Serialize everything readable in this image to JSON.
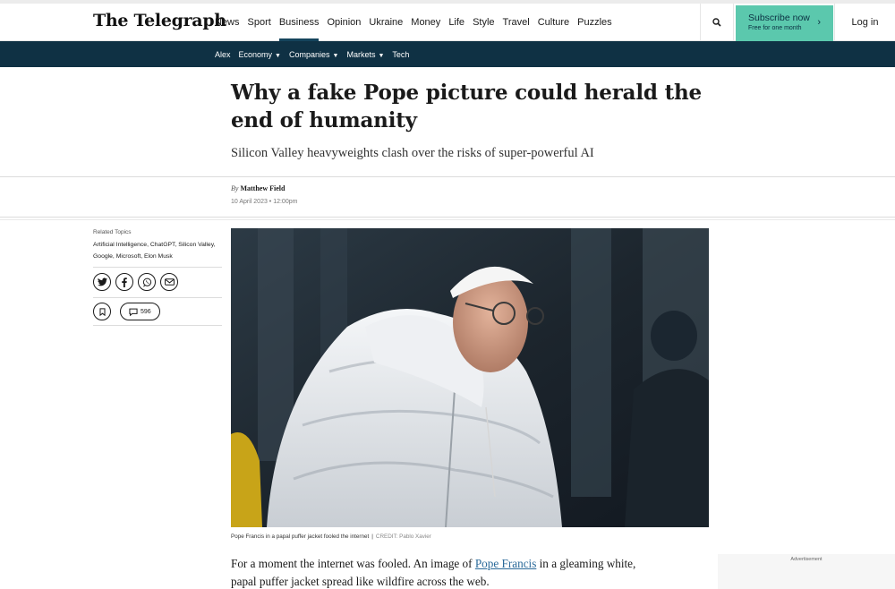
{
  "header": {
    "logo": "The Telegraph",
    "nav": [
      "News",
      "Sport",
      "Business",
      "Opinion",
      "Ukraine",
      "Money",
      "Life",
      "Style",
      "Travel",
      "Culture",
      "Puzzles"
    ],
    "active_nav": "Business",
    "subscribe_label": "Subscribe now",
    "subscribe_sub": "Free for one month",
    "login_label": "Log in"
  },
  "subnav": {
    "items": [
      {
        "label": "Alex",
        "dropdown": false
      },
      {
        "label": "Economy",
        "dropdown": true
      },
      {
        "label": "Companies",
        "dropdown": true
      },
      {
        "label": "Markets",
        "dropdown": true
      },
      {
        "label": "Tech",
        "dropdown": false
      }
    ]
  },
  "article": {
    "headline": "Why a fake Pope picture could herald the end of humanity",
    "standfirst": "Silicon Valley heavyweights clash over the risks of super-powerful AI",
    "by": "By",
    "author": "Matthew Field",
    "date": "10 April 2023 • 12:00pm",
    "caption": "Pope Francis in a papal puffer jacket fooled the internet",
    "caption_sep": "|",
    "credit": "CREDIT: Pablo Xavier",
    "para_before": "For a moment the internet was fooled. An image of ",
    "para_link": "Pope Francis",
    "para_after": " in a gleaming white, papal puffer jacket spread like wildfire across the web."
  },
  "rail": {
    "related_label": "Related Topics",
    "topics": "Artificial Intelligence, ChatGPT, Silicon Valley, Google, Microsoft, Elon Musk",
    "comment_count": "596"
  },
  "advert": {
    "label": "Advertisement"
  },
  "colors": {
    "subnav_bg": "#0f3144",
    "subscribe_bg": "#5bc8ad",
    "link": "#2b6a9a"
  }
}
